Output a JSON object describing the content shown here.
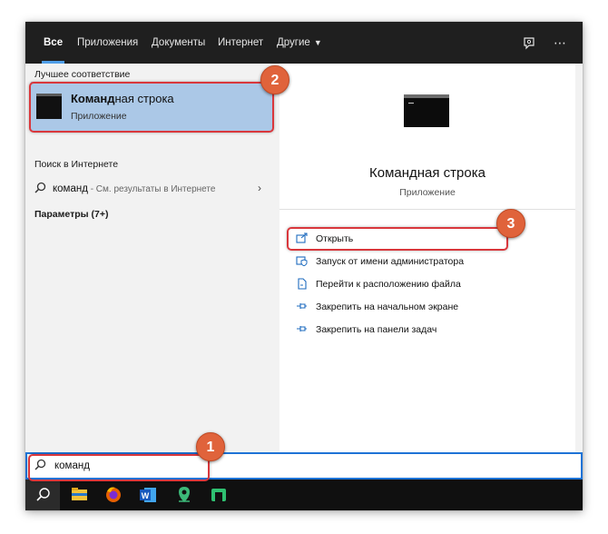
{
  "tabs": [
    {
      "label": "Все"
    },
    {
      "label": "Приложения"
    },
    {
      "label": "Документы"
    },
    {
      "label": "Интернет"
    },
    {
      "label": "Другие"
    }
  ],
  "topbar_icons": {
    "feedback": "feedback-icon",
    "more": "⋯"
  },
  "left": {
    "best_match_label": "Лучшее соответствие",
    "best_match": {
      "title_bold": "Команд",
      "title_rest": "ная строка",
      "subtitle": "Приложение"
    },
    "web_label": "Поиск в Интернете",
    "web_query": "команд",
    "web_hint": " - См. результаты в Интернете",
    "settings_label": "Параметры (7+)"
  },
  "right": {
    "title": "Командная строка",
    "subtitle": "Приложение",
    "actions": [
      {
        "label": "Открыть",
        "icon": "open-icon"
      },
      {
        "label": "Запуск от имени администратора",
        "icon": "run-as-admin-icon"
      },
      {
        "label": "Перейти к расположению файла",
        "icon": "file-location-icon"
      },
      {
        "label": "Закрепить на начальном экране",
        "icon": "pin-icon"
      },
      {
        "label": "Закрепить на панели задач",
        "icon": "pin-icon"
      }
    ]
  },
  "search": {
    "value": "команд"
  },
  "annotations": {
    "badge1": "1",
    "badge2": "2",
    "badge3": "3"
  },
  "colors": {
    "accent": "#1e73d6",
    "badge": "#e0633b",
    "highlight": "#d9373c",
    "selection": "#abc8e7"
  }
}
